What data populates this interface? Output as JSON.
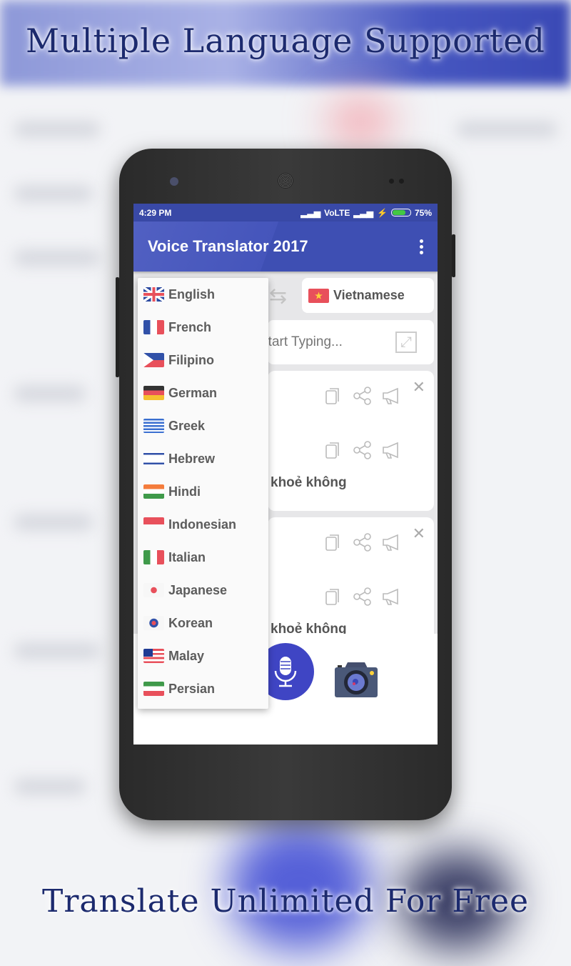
{
  "promo": {
    "headline_top": "Multiple Language Supported",
    "headline_bottom": "Translate Unlimited For Free"
  },
  "status_bar": {
    "time": "4:29 PM",
    "network": "VoLTE",
    "battery": "75%",
    "battery_level": 0.75
  },
  "app_bar": {
    "title": "Voice Translator 2017",
    "menu_icon": "more-vert-icon"
  },
  "target_language": {
    "label": "Vietnamese",
    "flag": "vietnam"
  },
  "input": {
    "placeholder": "Start Typing...",
    "expand_icon": "expand-icon"
  },
  "results": [
    {
      "translated_text": "khoẻ không"
    },
    {
      "translated_text": "khoẻ không"
    }
  ],
  "language_menu": {
    "items": [
      {
        "label": "English",
        "flag": "uk"
      },
      {
        "label": "French",
        "flag": "france"
      },
      {
        "label": "Filipino",
        "flag": "philippines"
      },
      {
        "label": "German",
        "flag": "germany"
      },
      {
        "label": "Greek",
        "flag": "greece"
      },
      {
        "label": "Hebrew",
        "flag": "israel"
      },
      {
        "label": "Hindi",
        "flag": "india"
      },
      {
        "label": "Indonesian",
        "flag": "indonesia"
      },
      {
        "label": "Italian",
        "flag": "italy"
      },
      {
        "label": "Japanese",
        "flag": "japan"
      },
      {
        "label": "Korean",
        "flag": "korea"
      },
      {
        "label": "Malay",
        "flag": "malaysia"
      },
      {
        "label": "Persian",
        "flag": "iran"
      }
    ]
  },
  "colors": {
    "primary": "#3f51b5",
    "status": "#3949a7",
    "mic": "#3f45c4",
    "headline": "#1c2a6e"
  }
}
